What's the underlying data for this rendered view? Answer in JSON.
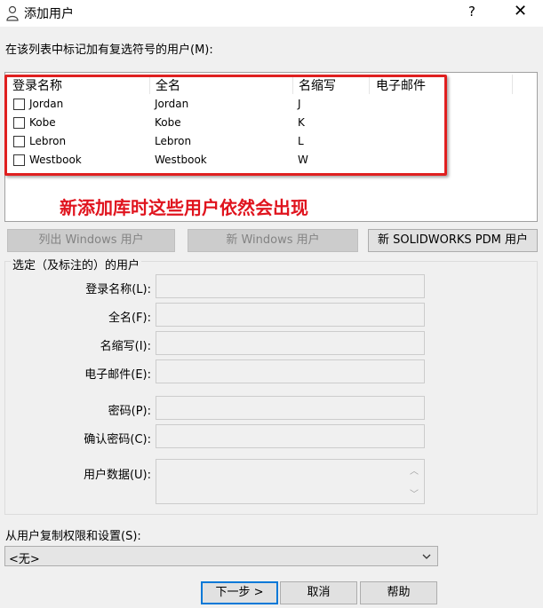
{
  "window": {
    "title": "添加用户",
    "help_glyph": "?",
    "close_glyph": "✕"
  },
  "instruction": "在该列表中标记加有复选符号的用户(M):",
  "user_list": {
    "columns": [
      "登录名称",
      "全名",
      "名缩写",
      "电子邮件"
    ],
    "rows": [
      {
        "login": "Jordan",
        "full_name": "Jordan",
        "initials": "J",
        "email": "",
        "checked": false
      },
      {
        "login": "Kobe",
        "full_name": "Kobe",
        "initials": "K",
        "email": "",
        "checked": false
      },
      {
        "login": "Lebron",
        "full_name": "Lebron",
        "initials": "L",
        "email": "",
        "checked": false
      },
      {
        "login": "Westbook",
        "full_name": "Westbook",
        "initials": "W",
        "email": "",
        "checked": false
      }
    ]
  },
  "annotation": "新添加库时这些用户依然会出现",
  "buttons": {
    "list_windows": "列出 Windows 用户",
    "new_windows": "新 Windows 用户",
    "new_pdm": "新 SOLIDWORKS PDM 用户",
    "next": "下一步 >",
    "cancel": "取消",
    "help": "帮助"
  },
  "selected_group": {
    "title": "选定（及标注的）的用户",
    "login_label": "登录名称(L):",
    "fullname_label": "全名(F):",
    "initials_label": "名缩写(I):",
    "email_label": "电子邮件(E):",
    "password_label": "密码(P):",
    "confirm_label": "确认密码(C):",
    "userdata_label": "用户数据(U):"
  },
  "copy_settings": {
    "label": "从用户复制权限和设置(S):",
    "selected": "<无>"
  },
  "colors": {
    "highlight": "#e02020",
    "annotation": "#e0141e"
  }
}
